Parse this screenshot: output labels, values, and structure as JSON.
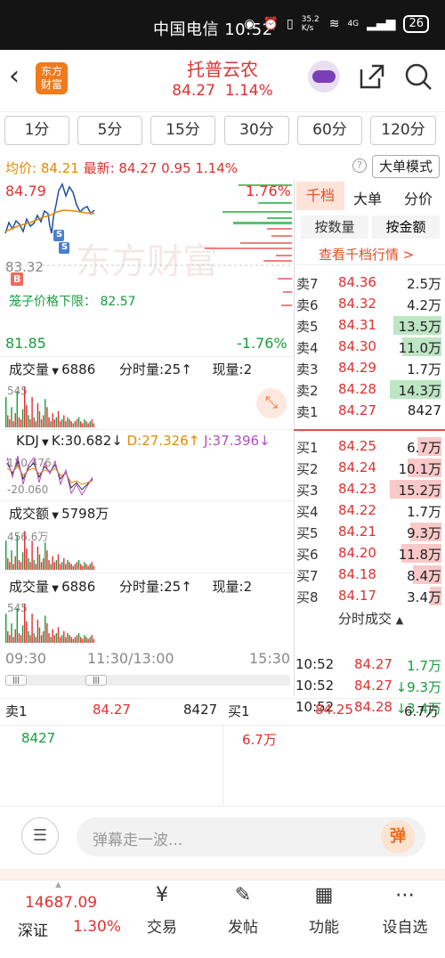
{
  "status": {
    "carrier_time": "中国电信 10:52",
    "net_speed": "35.2 K/s",
    "signal": "4G",
    "battery": "26"
  },
  "header": {
    "brand_line1": "东方",
    "brand_line2": "财富",
    "stock_name": "托普云农",
    "price": "84.27",
    "change_pct": "1.14%"
  },
  "tabs": [
    "1分",
    "5分",
    "15分",
    "30分",
    "60分",
    "120分"
  ],
  "info": {
    "avg_label": "均价:",
    "avg": "84.21",
    "latest_label": "最新:",
    "latest": "84.27",
    "change": "0.95",
    "change_pct": "1.14%",
    "big_order_mode": "大单模式"
  },
  "chart": {
    "top_price": "84.79",
    "top_pct": "1.76%",
    "mid_price": "83.32",
    "bottom_price": "81.85",
    "bottom_pct": "-1.76%",
    "cage_label": "笼子价格下限：",
    "cage_value": "82.57",
    "watermark": "东方财富",
    "buy_marker": "B",
    "sell_marker": "S"
  },
  "volume": {
    "label": "成交量",
    "value": "6886",
    "fen_label": "分时量:",
    "fen_value": "25↑",
    "cur_label": "现量:",
    "cur_value": "2",
    "axis_max": "545"
  },
  "kdj": {
    "label": "KDJ",
    "k": "K:30.682↓",
    "d": "D:27.326↑",
    "j": "J:37.396↓",
    "axis_top": "110.476",
    "axis_bottom": "-20.060"
  },
  "amount": {
    "label": "成交额",
    "value": "5798万",
    "axis_max": "456.6万"
  },
  "volume2": {
    "label": "成交量",
    "value": "6886",
    "fen_label": "分时量:",
    "fen_value": "25↑",
    "cur_label": "现量:",
    "cur_value": "2",
    "axis_max": "545"
  },
  "time_axis": [
    "09:30",
    "11:30/13:00",
    "15:30"
  ],
  "orderbook": {
    "tab_qiandang": "千档",
    "tab_dadan": "大单",
    "tab_fenjia": "分价",
    "by_qty": "按数量",
    "by_amt": "按金额",
    "view_link": "查看千档行情 >",
    "asks": [
      {
        "label": "卖7",
        "price": "84.36",
        "vol": "2.5万",
        "bar": 0
      },
      {
        "label": "卖6",
        "price": "84.32",
        "vol": "4.2万",
        "bar": 0
      },
      {
        "label": "卖5",
        "price": "84.31",
        "vol": "13.5万",
        "bar": 0.93
      },
      {
        "label": "卖4",
        "price": "84.30",
        "vol": "11.0万",
        "bar": 0.76
      },
      {
        "label": "卖3",
        "price": "84.29",
        "vol": "1.7万",
        "bar": 0
      },
      {
        "label": "卖2",
        "price": "84.28",
        "vol": "14.3万",
        "bar": 1
      },
      {
        "label": "卖1",
        "price": "84.27",
        "vol": "8427",
        "bar": 0
      }
    ],
    "bids": [
      {
        "label": "买1",
        "price": "84.25",
        "vol": "6.7万",
        "bar": 0.47
      },
      {
        "label": "买2",
        "price": "84.24",
        "vol": "10.1万",
        "bar": 0.66
      },
      {
        "label": "买3",
        "price": "84.23",
        "vol": "15.2万",
        "bar": 1
      },
      {
        "label": "买4",
        "price": "84.22",
        "vol": "1.7万",
        "bar": 0
      },
      {
        "label": "买5",
        "price": "84.21",
        "vol": "9.3万",
        "bar": 0.6
      },
      {
        "label": "买6",
        "price": "84.20",
        "vol": "11.8万",
        "bar": 0.77
      },
      {
        "label": "买7",
        "price": "84.18",
        "vol": "8.4万",
        "bar": 0.55
      },
      {
        "label": "买8",
        "price": "84.17",
        "vol": "3.4万",
        "bar": 0.22
      }
    ],
    "ticks_title": "分时成交",
    "ticks": [
      {
        "time": "10:52",
        "price": "84.27",
        "vol": "1.7万"
      },
      {
        "time": "10:52",
        "price": "84.27",
        "vol": "↓9.3万"
      },
      {
        "time": "10:52",
        "price": "84.28",
        "vol": "↓3.4万"
      }
    ]
  },
  "summary": {
    "sell1_label": "卖1",
    "sell1_price": "84.27",
    "sell1_vol": "8427",
    "buy1_label": "买1",
    "buy1_price": "84.25",
    "buy1_vol": "6.7万",
    "sell_detail": "8427",
    "buy_detail": "6.7万"
  },
  "comment": {
    "placeholder": "弹幕走一波...",
    "danmu_btn": "弹"
  },
  "bottom": {
    "index_value": "14687.09",
    "index_name": "深证",
    "index_pct": "1.30%",
    "trade": "交易",
    "post": "发帖",
    "func": "功能",
    "custom": "设自选"
  }
}
